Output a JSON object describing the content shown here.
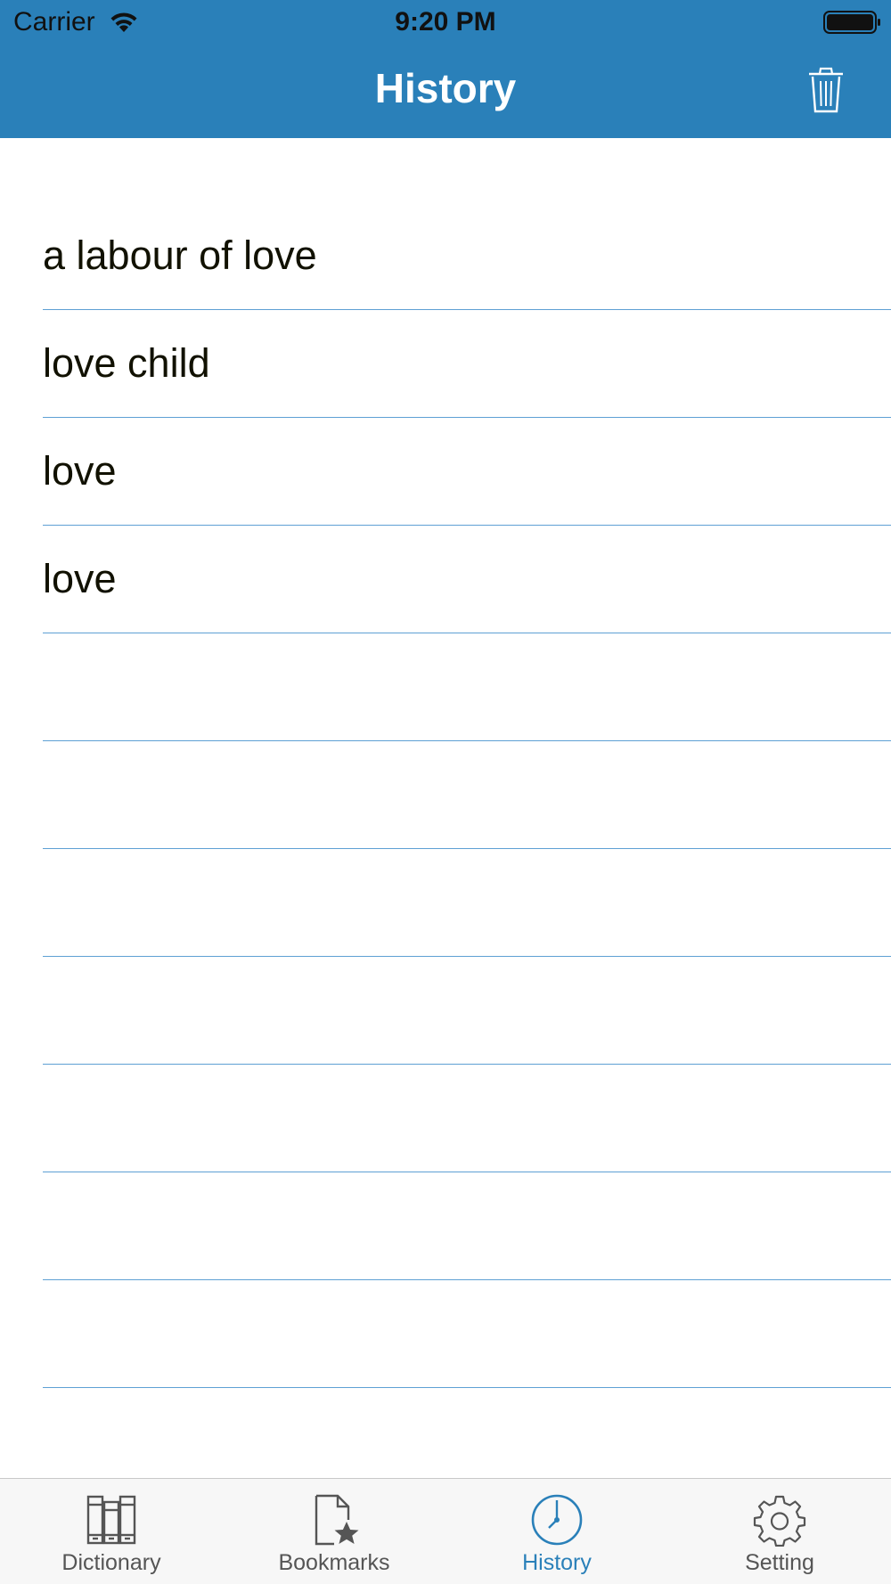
{
  "status_bar": {
    "carrier": "Carrier",
    "time": "9:20 PM"
  },
  "header": {
    "title": "History",
    "trash_icon": "trash-icon",
    "background_color": "#2a80b9"
  },
  "history": {
    "items": [
      {
        "label": "a labour of love"
      },
      {
        "label": "love child"
      },
      {
        "label": "love"
      },
      {
        "label": "love"
      },
      {
        "label": ""
      },
      {
        "label": ""
      },
      {
        "label": ""
      },
      {
        "label": ""
      },
      {
        "label": ""
      },
      {
        "label": ""
      },
      {
        "label": ""
      }
    ],
    "separator_color": "#5ea0d4"
  },
  "tab_bar": {
    "active_color": "#2a80b9",
    "tabs": [
      {
        "label": "Dictionary",
        "icon": "books-icon",
        "active": false
      },
      {
        "label": "Bookmarks",
        "icon": "bookmark-star-icon",
        "active": false
      },
      {
        "label": "History",
        "icon": "clock-icon",
        "active": true
      },
      {
        "label": "Setting",
        "icon": "gear-icon",
        "active": false
      }
    ]
  }
}
